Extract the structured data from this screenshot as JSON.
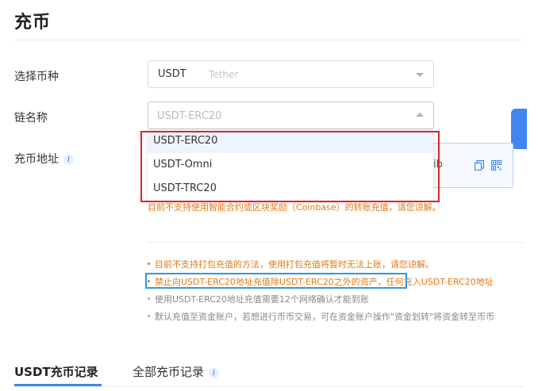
{
  "page": {
    "title": "充币"
  },
  "form": {
    "currency_label": "选择币种",
    "currency_symbol": "USDT",
    "currency_name": "Tether",
    "chain_label": "链名称",
    "chain_placeholder": "USDT-ERC20",
    "address_label": "充币地址",
    "address_tail": "ib"
  },
  "dropdown": {
    "options": [
      "USDT-ERC20",
      "USDT-Omni",
      "USDT-TRC20"
    ],
    "selected": "USDT-ERC20"
  },
  "warning_text": "目前不支持使用智能合约或区块奖励（Coinbase）的转账充值，请您谅解。",
  "notes": [
    "目前不支持打包充值的方法，使用打包充值将暂时无法上账，请您谅解。",
    "禁止向USDT-ERC20地址充值除USDT-ERC20之外的资产，任何充入USDT-ERC20地址",
    "使用USDT-ERC20地址充值需要12个网络确认才能到账",
    "默认充值至资金账户，若想进行币币交易，可在资金账户操作\"资金划转\"将资金转至币币"
  ],
  "tabs": {
    "records": "USDT充币记录",
    "all_records": "全部充币记录"
  },
  "colors": {
    "accent": "#3f86f2",
    "warning": "#e27a16",
    "highlight_red": "#e02424",
    "highlight_blue": "#2a9ae0"
  },
  "icons": {
    "info": "info-icon",
    "caret": "chevron-down-icon",
    "copy": "copy-icon",
    "qr": "qr-code-icon"
  }
}
